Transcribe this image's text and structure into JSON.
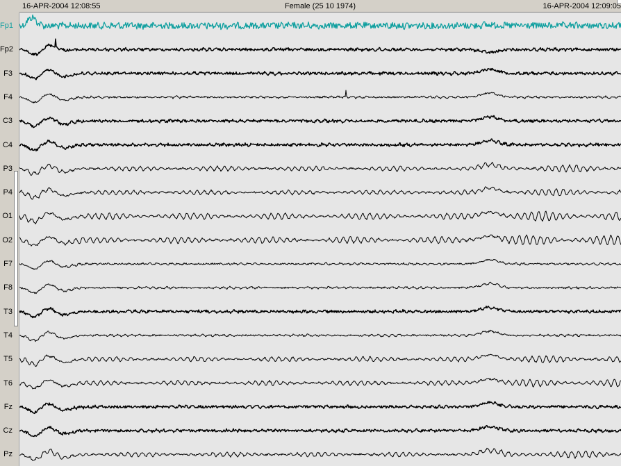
{
  "header": {
    "start_time": "16-APR-2004 12:08:55",
    "patient": "Female (25 10 1974)",
    "end_time": "16-APR-2004 12:09:05"
  },
  "colors": {
    "background": "#e6e6e6",
    "trace": "#000000",
    "selected_trace": "#0f9f9f",
    "panel": "#d4d0c8"
  },
  "selected_channel": "Fp1",
  "channels": [
    {
      "label": "Fp1"
    },
    {
      "label": "Fp2"
    },
    {
      "label": "F3"
    },
    {
      "label": "F4"
    },
    {
      "label": "C3"
    },
    {
      "label": "C4"
    },
    {
      "label": "P3"
    },
    {
      "label": "P4"
    },
    {
      "label": "O1"
    },
    {
      "label": "O2"
    },
    {
      "label": "F7"
    },
    {
      "label": "F8"
    },
    {
      "label": "T3"
    },
    {
      "label": "T4"
    },
    {
      "label": "T5"
    },
    {
      "label": "T6"
    },
    {
      "label": "Fz"
    },
    {
      "label": "Cz"
    },
    {
      "label": "Pz"
    }
  ]
}
